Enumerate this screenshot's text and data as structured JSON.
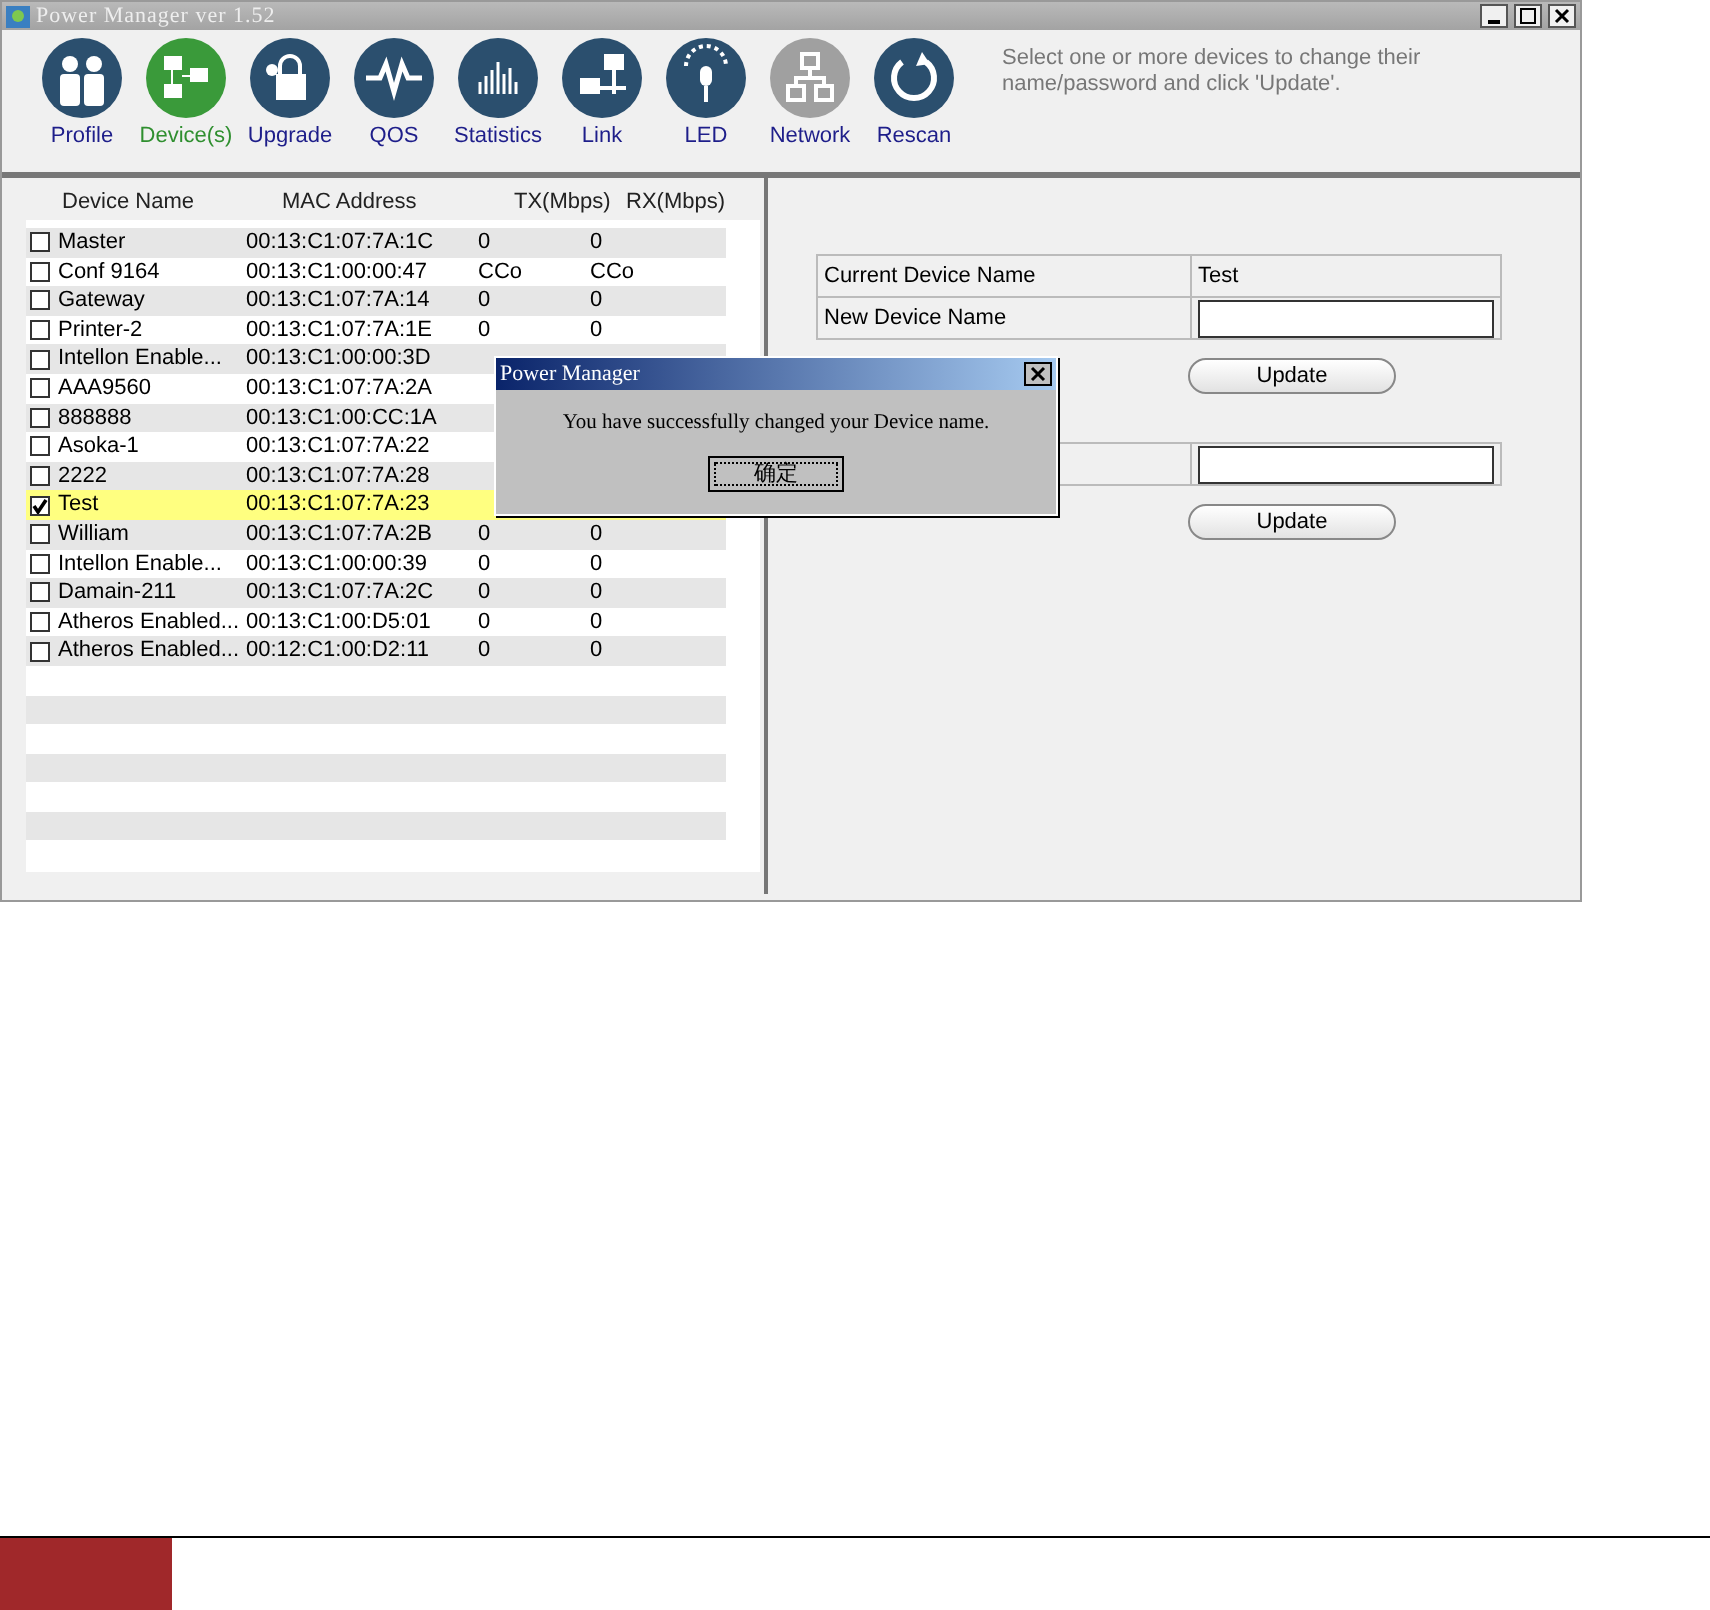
{
  "window": {
    "title": "Power Manager ver 1.52"
  },
  "toolbar": [
    {
      "label": "Profile",
      "selected": false,
      "disabled": false
    },
    {
      "label": "Device(s)",
      "selected": true,
      "disabled": false
    },
    {
      "label": "Upgrade",
      "selected": false,
      "disabled": false
    },
    {
      "label": "QOS",
      "selected": false,
      "disabled": false
    },
    {
      "label": "Statistics",
      "selected": false,
      "disabled": false
    },
    {
      "label": "Link",
      "selected": false,
      "disabled": false
    },
    {
      "label": "LED",
      "selected": false,
      "disabled": false
    },
    {
      "label": "Network",
      "selected": false,
      "disabled": true
    },
    {
      "label": "Rescan",
      "selected": false,
      "disabled": false
    }
  ],
  "hint": "Select one or more devices to change their name/password and click 'Update'.",
  "device_table": {
    "columns": [
      "Device Name",
      "MAC Address",
      "TX(Mbps)",
      "RX(Mbps)"
    ],
    "rows": [
      {
        "name": "Master",
        "mac": "00:13:C1:07:7A:1C",
        "tx": "0",
        "rx": "0",
        "checked": false,
        "selected": false
      },
      {
        "name": "Conf 9164",
        "mac": "00:13:C1:00:00:47",
        "tx": "CCo",
        "rx": "CCo",
        "checked": false,
        "selected": false
      },
      {
        "name": "Gateway",
        "mac": "00:13:C1:07:7A:14",
        "tx": "0",
        "rx": "0",
        "checked": false,
        "selected": false
      },
      {
        "name": "Printer-2",
        "mac": "00:13:C1:07:7A:1E",
        "tx": "0",
        "rx": "0",
        "checked": false,
        "selected": false
      },
      {
        "name": "Intellon Enable...",
        "mac": "00:13:C1:00:00:3D",
        "checked": false,
        "selected": false
      },
      {
        "name": "AAA9560",
        "mac": "00:13:C1:07:7A:2A",
        "checked": false,
        "selected": false
      },
      {
        "name": "888888",
        "mac": "00:13:C1:00:CC:1A",
        "checked": false,
        "selected": false
      },
      {
        "name": "Asoka-1",
        "mac": "00:13:C1:07:7A:22",
        "checked": false,
        "selected": false
      },
      {
        "name": "2222",
        "mac": "00:13:C1:07:7A:28",
        "checked": false,
        "selected": false
      },
      {
        "name": "Test",
        "mac": "00:13:C1:07:7A:23",
        "checked": true,
        "selected": true
      },
      {
        "name": "William",
        "mac": "00:13:C1:07:7A:2B",
        "tx": "0",
        "rx": "0",
        "checked": false,
        "selected": false
      },
      {
        "name": "Intellon Enable...",
        "mac": "00:13:C1:00:00:39",
        "tx": "0",
        "rx": "0",
        "checked": false,
        "selected": false
      },
      {
        "name": "Damain-211",
        "mac": "00:13:C1:07:7A:2C",
        "tx": "0",
        "rx": "0",
        "checked": false,
        "selected": false
      },
      {
        "name": "Atheros Enabled...",
        "mac": "00:13:C1:00:D5:01",
        "tx": "0",
        "rx": "0",
        "checked": false,
        "selected": false
      },
      {
        "name": "Atheros Enabled...",
        "mac": "00:12:C1:00:D2:11",
        "tx": "0",
        "rx": "0",
        "checked": false,
        "selected": false
      }
    ]
  },
  "device_form": {
    "rows": [
      {
        "kind": "text",
        "label": "Current Device Name",
        "value": "Test"
      },
      {
        "kind": "input",
        "label": "New Device Name"
      }
    ],
    "button": "Update"
  },
  "password_form": {
    "rows": [
      {
        "kind": "input"
      }
    ],
    "button": "Update"
  },
  "dialog": {
    "title": "Power Manager",
    "message": "You have successfully changed your Device name.",
    "button": "确定"
  }
}
